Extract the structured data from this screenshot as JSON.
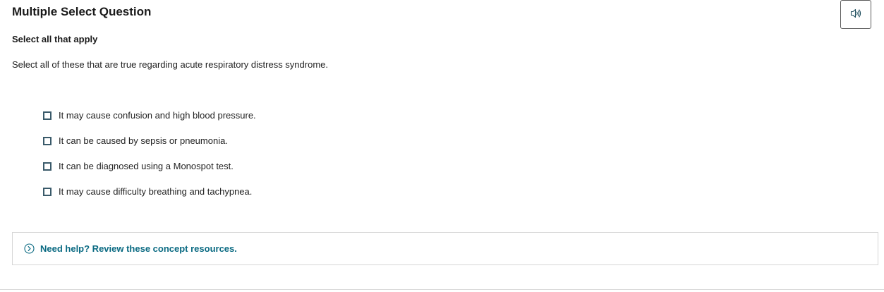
{
  "header": {
    "question_type": "Multiple Select Question",
    "audio_icon": "speaker-icon"
  },
  "question": {
    "instruction": "Select all that apply",
    "prompt": "Select all of these that are true regarding acute respiratory distress syndrome.",
    "options": [
      {
        "label": "It may cause confusion and high blood pressure.",
        "checked": false
      },
      {
        "label": "It can be caused by sepsis or pneumonia.",
        "checked": false
      },
      {
        "label": "It can be diagnosed using a Monospot test.",
        "checked": false
      },
      {
        "label": "It may cause difficulty breathing and tachypnea.",
        "checked": false
      }
    ]
  },
  "help": {
    "label": "Need help? Review these concept resources.",
    "icon": "chevron-right-circle-icon",
    "color": "#0a6a82"
  }
}
